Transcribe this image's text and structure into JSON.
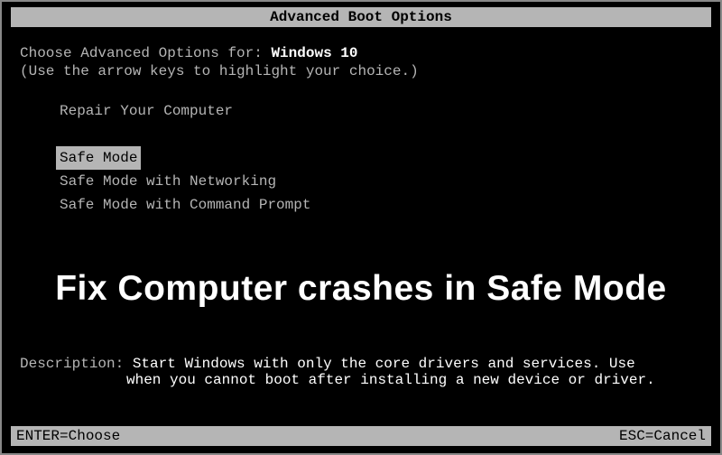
{
  "title": "Advanced Boot Options",
  "prompt_prefix": "Choose Advanced Options for: ",
  "os_name": "Windows 10",
  "hint": "(Use the arrow keys to highlight your choice.)",
  "menu": {
    "repair": "Repair Your Computer",
    "safe_mode": "Safe Mode",
    "safe_mode_net": "Safe Mode with Networking",
    "safe_mode_cmd": "Safe Mode with Command Prompt"
  },
  "overlay_caption": "Fix Computer crashes in Safe Mode",
  "description": {
    "label": "Description: ",
    "line1": "Start Windows with only the core drivers and services. Use",
    "line2": "when you cannot boot after installing a new device or driver."
  },
  "footer": {
    "enter": "ENTER=Choose",
    "esc": "ESC=Cancel"
  }
}
